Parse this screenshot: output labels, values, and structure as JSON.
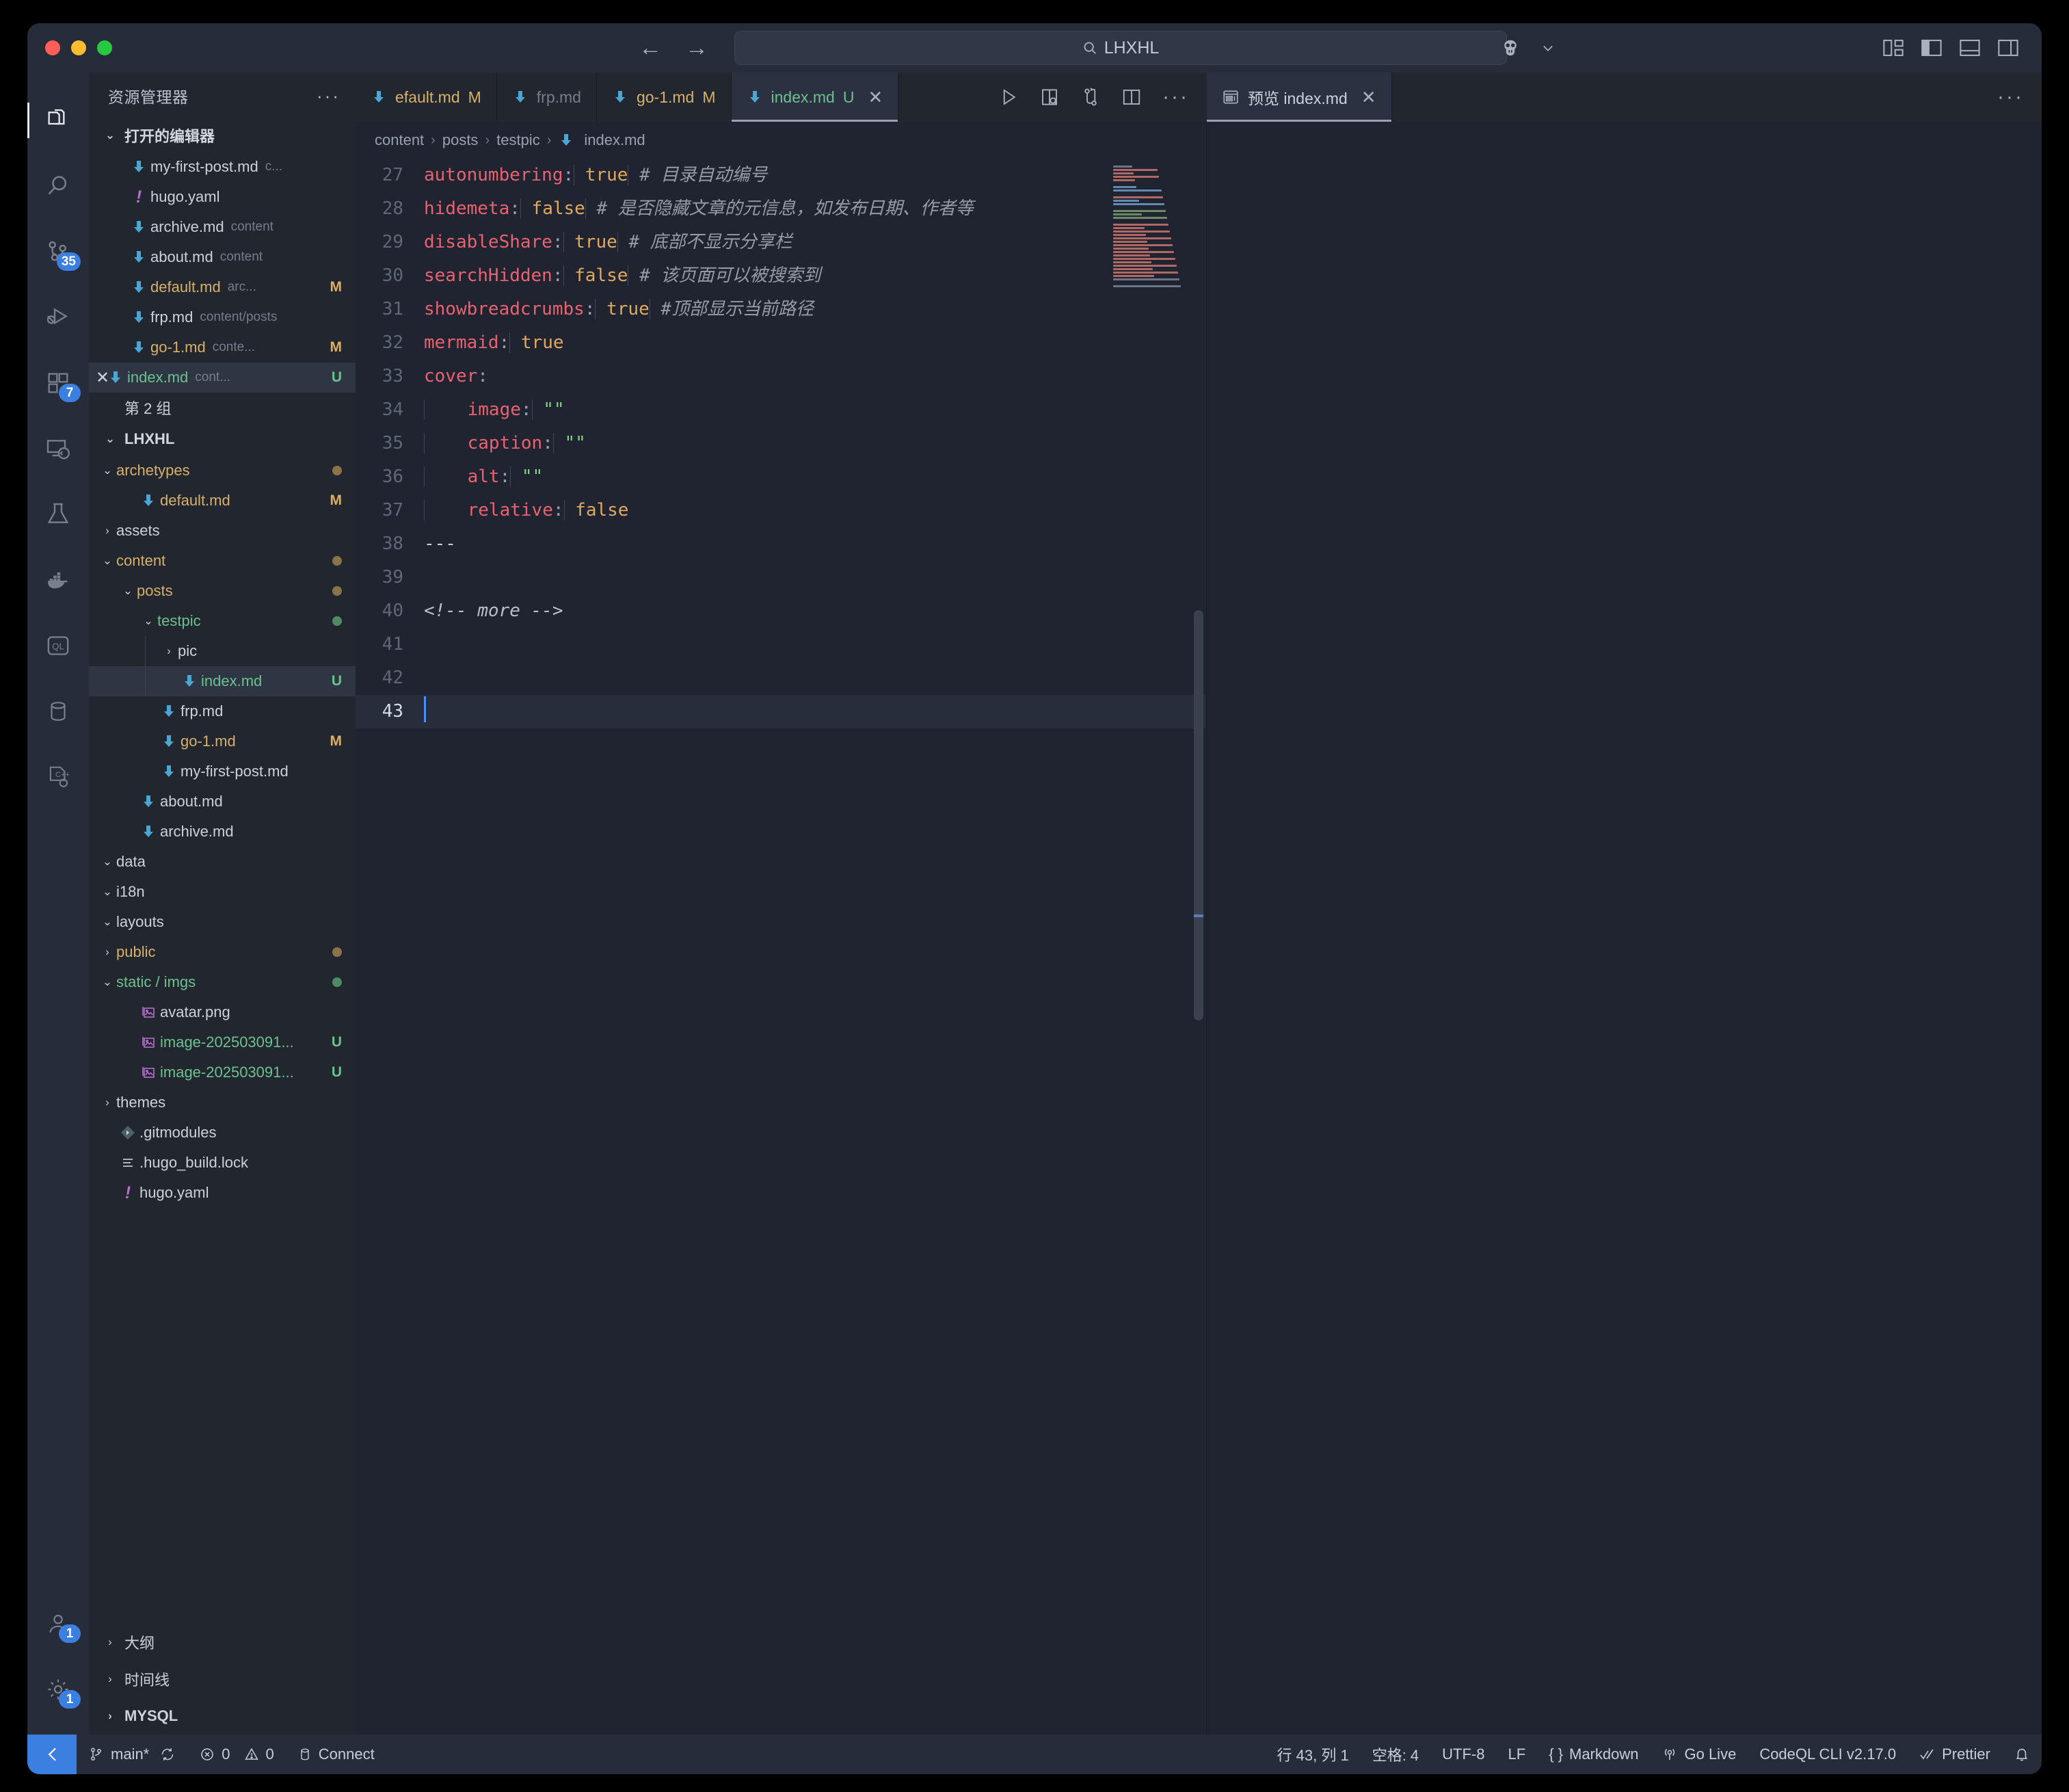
{
  "titlebar": {
    "search_value": "LHXHL",
    "search_icon": "search-icon",
    "back_icon": "back-arrow-icon",
    "forward_icon": "forward-arrow-icon",
    "account_icon": "account-icon",
    "chevron": "chevron-down-icon"
  },
  "activitybar": {
    "items": [
      {
        "name": "explorer",
        "icon": "files-icon",
        "badge": ""
      },
      {
        "name": "search",
        "icon": "search-icon",
        "badge": ""
      },
      {
        "name": "source-control",
        "icon": "source-control-icon",
        "badge": "35"
      },
      {
        "name": "run-debug",
        "icon": "run-and-debug-icon",
        "badge": ""
      },
      {
        "name": "extensions",
        "icon": "extensions-icon",
        "badge": "7"
      },
      {
        "name": "remote-explorer",
        "icon": "remote-explorer-icon",
        "badge": ""
      },
      {
        "name": "testing",
        "icon": "beaker-icon",
        "badge": ""
      },
      {
        "name": "docker",
        "icon": "docker-icon",
        "badge": ""
      },
      {
        "name": "codeql",
        "icon": "codeql-icon",
        "badge": ""
      },
      {
        "name": "database",
        "icon": "database-icon",
        "badge": ""
      },
      {
        "name": "cpp-config",
        "icon": "cpp-config-icon",
        "badge": ""
      }
    ],
    "bottom": [
      {
        "name": "accounts",
        "icon": "account-icon",
        "badge": "1"
      },
      {
        "name": "settings",
        "icon": "gear-icon",
        "badge": "1"
      }
    ]
  },
  "sidebar": {
    "title": "资源管理器",
    "more_label": "···",
    "open_editors": {
      "label": "打开的编辑器",
      "items": [
        {
          "name": "my-first-post.md",
          "desc": "c...",
          "status": "",
          "icon": "markdown-icon",
          "color": "def"
        },
        {
          "name": "hugo.yaml",
          "desc": "",
          "status": "",
          "icon": "yaml-icon",
          "color": "def"
        },
        {
          "name": "archive.md",
          "desc": "content",
          "status": "",
          "icon": "markdown-icon",
          "color": "def"
        },
        {
          "name": "about.md",
          "desc": "content",
          "status": "",
          "icon": "markdown-icon",
          "color": "def"
        },
        {
          "name": "default.md",
          "desc": "arc...",
          "status": "M",
          "icon": "markdown-icon",
          "color": "mod"
        },
        {
          "name": "frp.md",
          "desc": "content/posts",
          "status": "",
          "icon": "markdown-icon",
          "color": "def"
        },
        {
          "name": "go-1.md",
          "desc": "conte...",
          "status": "M",
          "icon": "markdown-icon",
          "color": "mod"
        },
        {
          "name": "index.md",
          "desc": "cont...",
          "status": "U",
          "icon": "markdown-icon",
          "color": "unt"
        }
      ],
      "group_label": "第 2 组"
    },
    "workspace": {
      "label": "LHXHL",
      "items": [
        {
          "name": "archetypes",
          "type": "folder",
          "expanded": true,
          "indent": 1,
          "color": "mod",
          "dot": "m"
        },
        {
          "name": "default.md",
          "type": "file",
          "indent": 2,
          "color": "mod",
          "status": "M",
          "icon": "markdown-icon"
        },
        {
          "name": "assets",
          "type": "folder",
          "expanded": false,
          "indent": 1,
          "color": "def"
        },
        {
          "name": "content",
          "type": "folder",
          "expanded": true,
          "indent": 1,
          "color": "mod",
          "dot": "m"
        },
        {
          "name": "posts",
          "type": "folder",
          "expanded": true,
          "indent": 2,
          "color": "mod",
          "dot": "m"
        },
        {
          "name": "testpic",
          "type": "folder",
          "expanded": true,
          "indent": 3,
          "color": "unt",
          "dot": "u"
        },
        {
          "name": "pic",
          "type": "folder",
          "expanded": false,
          "indent": 4,
          "color": "def"
        },
        {
          "name": "index.md",
          "type": "file",
          "indent": 4,
          "color": "unt",
          "status": "U",
          "icon": "markdown-icon",
          "selected": true
        },
        {
          "name": "frp.md",
          "type": "file",
          "indent": 3,
          "color": "def",
          "icon": "markdown-icon"
        },
        {
          "name": "go-1.md",
          "type": "file",
          "indent": 3,
          "color": "mod",
          "status": "M",
          "icon": "markdown-icon"
        },
        {
          "name": "my-first-post.md",
          "type": "file",
          "indent": 3,
          "color": "def",
          "icon": "markdown-icon"
        },
        {
          "name": "about.md",
          "type": "file",
          "indent": 2,
          "color": "def",
          "icon": "markdown-icon"
        },
        {
          "name": "archive.md",
          "type": "file",
          "indent": 2,
          "color": "def",
          "icon": "markdown-icon"
        },
        {
          "name": "data",
          "type": "folder",
          "expanded": true,
          "indent": 1,
          "color": "def"
        },
        {
          "name": "i18n",
          "type": "folder",
          "expanded": true,
          "indent": 1,
          "color": "def"
        },
        {
          "name": "layouts",
          "type": "folder",
          "expanded": true,
          "indent": 1,
          "color": "def"
        },
        {
          "name": "public",
          "type": "folder",
          "expanded": false,
          "indent": 1,
          "color": "mod",
          "dot": "m"
        },
        {
          "name": "static / imgs",
          "type": "folder",
          "expanded": true,
          "indent": 1,
          "color": "unt",
          "dot": "u"
        },
        {
          "name": "avatar.png",
          "type": "file",
          "indent": 2,
          "color": "def",
          "icon": "image-icon"
        },
        {
          "name": "image-202503091...",
          "type": "file",
          "indent": 2,
          "color": "unt",
          "status": "U",
          "icon": "image-icon"
        },
        {
          "name": "image-202503091...",
          "type": "file",
          "indent": 2,
          "color": "unt",
          "status": "U",
          "icon": "image-icon"
        },
        {
          "name": "themes",
          "type": "folder",
          "expanded": false,
          "indent": 1,
          "color": "def"
        },
        {
          "name": ".gitmodules",
          "type": "file",
          "indent": 1,
          "color": "def",
          "icon": "git-icon"
        },
        {
          "name": ".hugo_build.lock",
          "type": "file",
          "indent": 1,
          "color": "def",
          "icon": "lock-file-icon"
        },
        {
          "name": "hugo.yaml",
          "type": "file",
          "indent": 1,
          "color": "def",
          "icon": "yaml-icon"
        }
      ]
    },
    "panels": [
      {
        "label": "大纲",
        "bold": false
      },
      {
        "label": "时间线",
        "bold": false
      },
      {
        "label": "MYSQL",
        "bold": true
      }
    ]
  },
  "editor": {
    "tabs_left": [
      {
        "label": "efault.md",
        "status": "M",
        "icon": "markdown-icon",
        "active": false,
        "color": "mod"
      },
      {
        "label": "frp.md",
        "status": "",
        "icon": "markdown-icon",
        "active": false,
        "color": "dim"
      },
      {
        "label": "go-1.md",
        "status": "M",
        "icon": "markdown-icon",
        "active": false,
        "color": "mod"
      },
      {
        "label": "index.md",
        "status": "U",
        "icon": "markdown-icon",
        "active": true,
        "color": "unt"
      }
    ],
    "tab_actions": [
      {
        "name": "run-icon",
        "label": "▷"
      },
      {
        "name": "open-preview-to-side-icon",
        "label": ""
      },
      {
        "name": "source-control-compare-icon",
        "label": ""
      },
      {
        "name": "split-editor-icon",
        "label": ""
      },
      {
        "name": "more-actions-icon",
        "label": "···"
      }
    ],
    "tabs_right": [
      {
        "label": "预览 index.md",
        "icon": "preview-icon",
        "active": true
      }
    ],
    "right_more_icon": "···",
    "breadcrumb": [
      "content",
      "posts",
      "testpic",
      "index.md"
    ],
    "breadcrumb_file_icon": "markdown-icon",
    "lines": [
      {
        "no": "27",
        "tokens": [
          {
            "t": "autonumbering",
            "c": "key"
          },
          {
            "t": ":",
            "c": "colon"
          },
          {
            "t": " ",
            "c": "pun"
          },
          {
            "t": "true",
            "c": "bool"
          },
          {
            "t": " ",
            "c": "pun"
          },
          {
            "t": "# 目录自动编号",
            "c": "com"
          }
        ]
      },
      {
        "no": "28",
        "tokens": [
          {
            "t": "hidemeta",
            "c": "key"
          },
          {
            "t": ":",
            "c": "colon"
          },
          {
            "t": " ",
            "c": "pun"
          },
          {
            "t": "false",
            "c": "bool"
          },
          {
            "t": " ",
            "c": "pun"
          },
          {
            "t": "# 是否隐藏文章的元信息，如发布日期、作者等",
            "c": "com"
          }
        ]
      },
      {
        "no": "29",
        "tokens": [
          {
            "t": "disableShare",
            "c": "key"
          },
          {
            "t": ":",
            "c": "colon"
          },
          {
            "t": " ",
            "c": "pun"
          },
          {
            "t": "true",
            "c": "bool"
          },
          {
            "t": " ",
            "c": "pun"
          },
          {
            "t": "# 底部不显示分享栏",
            "c": "com"
          }
        ]
      },
      {
        "no": "30",
        "tokens": [
          {
            "t": "searchHidden",
            "c": "key"
          },
          {
            "t": ":",
            "c": "colon"
          },
          {
            "t": " ",
            "c": "pun"
          },
          {
            "t": "false",
            "c": "bool"
          },
          {
            "t": " ",
            "c": "pun"
          },
          {
            "t": "# 该页面可以被搜索到",
            "c": "com"
          }
        ]
      },
      {
        "no": "31",
        "tokens": [
          {
            "t": "showbreadcrumbs",
            "c": "key"
          },
          {
            "t": ":",
            "c": "colon"
          },
          {
            "t": " ",
            "c": "pun"
          },
          {
            "t": "true",
            "c": "bool"
          },
          {
            "t": " ",
            "c": "pun"
          },
          {
            "t": "#顶部显示当前路径",
            "c": "com"
          }
        ]
      },
      {
        "no": "32",
        "tokens": [
          {
            "t": "mermaid",
            "c": "key"
          },
          {
            "t": ":",
            "c": "colon"
          },
          {
            "t": " ",
            "c": "pun"
          },
          {
            "t": "true",
            "c": "bool"
          }
        ]
      },
      {
        "no": "33",
        "tokens": [
          {
            "t": "cover",
            "c": "key"
          },
          {
            "t": ":",
            "c": "colon"
          }
        ]
      },
      {
        "no": "34",
        "tokens": [
          {
            "t": "    ",
            "c": "pun"
          },
          {
            "t": "image",
            "c": "key"
          },
          {
            "t": ":",
            "c": "colon"
          },
          {
            "t": " ",
            "c": "pun"
          },
          {
            "t": "\"\"",
            "c": "str"
          }
        ]
      },
      {
        "no": "35",
        "tokens": [
          {
            "t": "    ",
            "c": "pun"
          },
          {
            "t": "caption",
            "c": "key"
          },
          {
            "t": ":",
            "c": "colon"
          },
          {
            "t": " ",
            "c": "pun"
          },
          {
            "t": "\"\"",
            "c": "str"
          }
        ]
      },
      {
        "no": "36",
        "tokens": [
          {
            "t": "    ",
            "c": "pun"
          },
          {
            "t": "alt",
            "c": "key"
          },
          {
            "t": ":",
            "c": "colon"
          },
          {
            "t": " ",
            "c": "pun"
          },
          {
            "t": "\"\"",
            "c": "str"
          }
        ]
      },
      {
        "no": "37",
        "tokens": [
          {
            "t": "    ",
            "c": "pun"
          },
          {
            "t": "relative",
            "c": "key"
          },
          {
            "t": ":",
            "c": "colon"
          },
          {
            "t": " ",
            "c": "pun"
          },
          {
            "t": "false",
            "c": "bool"
          }
        ]
      },
      {
        "no": "38",
        "tokens": [
          {
            "t": "---",
            "c": "pun"
          }
        ]
      },
      {
        "no": "39",
        "tokens": []
      },
      {
        "no": "40",
        "tokens": [
          {
            "t": "<!-- more -->",
            "c": "html"
          }
        ]
      },
      {
        "no": "41",
        "tokens": []
      },
      {
        "no": "42",
        "tokens": []
      },
      {
        "no": "43",
        "tokens": [],
        "cursor": true
      }
    ]
  },
  "statusbar": {
    "remote_icon": "remote-window-icon",
    "left": [
      {
        "name": "branch",
        "icon": "git-branch-icon",
        "label": "main*"
      },
      {
        "name": "sync",
        "icon": "sync-icon",
        "label": ""
      },
      {
        "name": "errors",
        "icon": "error-icon",
        "label": "0"
      },
      {
        "name": "warnings",
        "icon": "warning-icon",
        "label": "0"
      },
      {
        "name": "database-connect",
        "icon": "database-icon",
        "label": "Connect"
      }
    ],
    "right": [
      {
        "name": "cursor-position",
        "icon": "",
        "label": "行 43, 列 1"
      },
      {
        "name": "indentation",
        "icon": "",
        "label": "空格: 4"
      },
      {
        "name": "encoding",
        "icon": "",
        "label": "UTF-8"
      },
      {
        "name": "eol",
        "icon": "",
        "label": "LF"
      },
      {
        "name": "language-mode",
        "icon": "braces-icon",
        "label": "Markdown"
      },
      {
        "name": "go-live",
        "icon": "broadcast-icon",
        "label": "Go Live"
      },
      {
        "name": "codeql-cli",
        "icon": "",
        "label": "CodeQL CLI v2.17.0"
      },
      {
        "name": "prettier",
        "icon": "check-icon",
        "label": "Prettier"
      },
      {
        "name": "notifications",
        "icon": "bell-icon",
        "label": ""
      }
    ]
  },
  "colors": {
    "accent": "#3b7fe0",
    "modified": "#d8b06a",
    "untracked": "#6cc18e",
    "caret": "#4d8df5"
  }
}
